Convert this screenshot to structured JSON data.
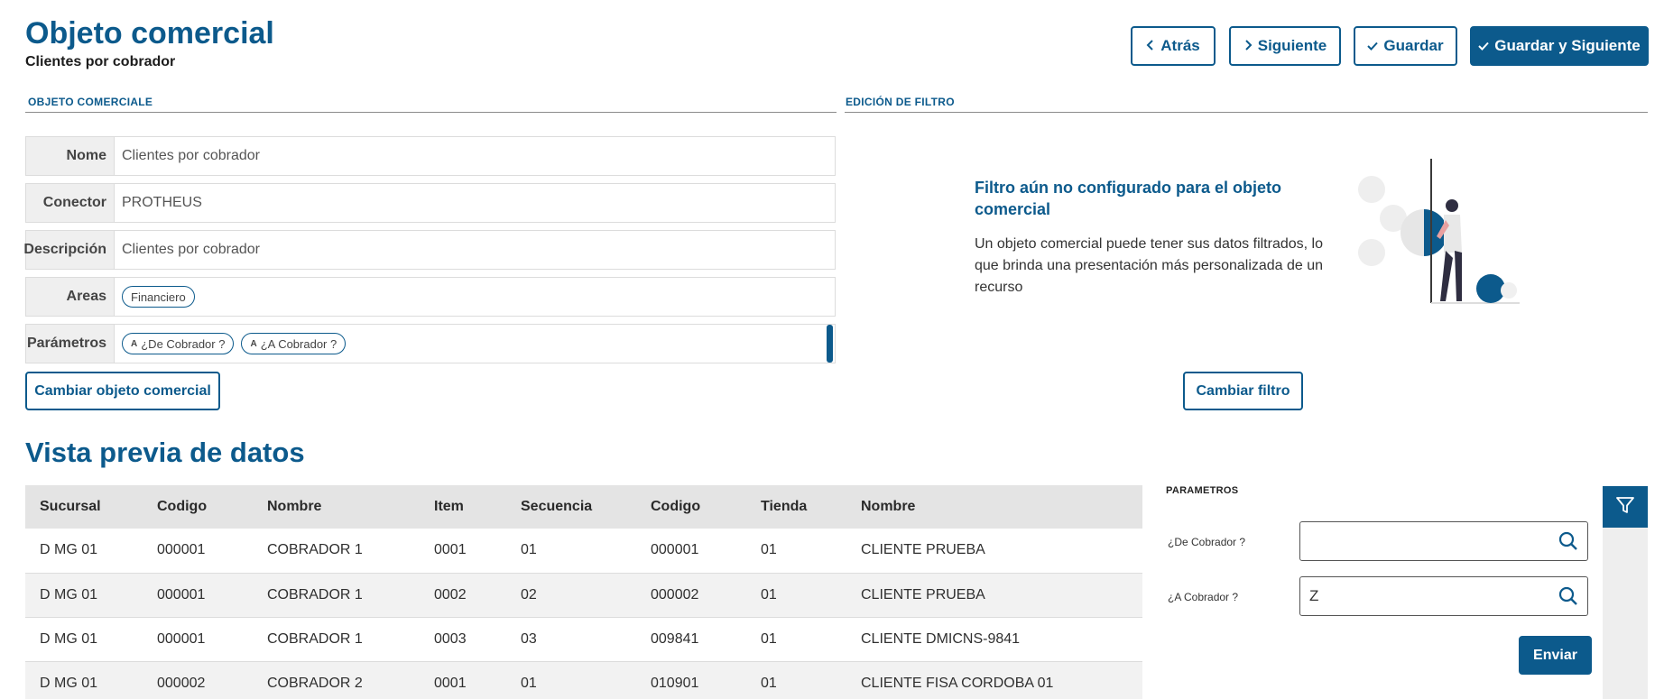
{
  "header": {
    "title": "Objeto comercial",
    "subtitle": "Clientes por cobrador"
  },
  "toolbar": {
    "back_label": "Atrás",
    "next_label": "Siguiente",
    "save_label": "Guardar",
    "save_next_label": "Guardar y Siguiente"
  },
  "object_section": {
    "header": "OBJETO COMERCIALE",
    "fields": {
      "name": {
        "label": "Nome",
        "value": "Clientes por cobrador"
      },
      "connector": {
        "label": "Conector",
        "value": "PROTHEUS"
      },
      "description": {
        "label": "Descripción",
        "value": "Clientes por cobrador"
      },
      "areas": {
        "label": "Areas",
        "chips": [
          "Financiero"
        ]
      },
      "parameters": {
        "label": "Parámetros",
        "chips": [
          "¿De Cobrador ?",
          "¿A Cobrador ?"
        ],
        "chip_icon": "A"
      }
    },
    "change_button": "Cambiar objeto comercial"
  },
  "filter_section": {
    "header": "EDICIÓN DE FILTRO",
    "empty_title": "Filtro aún no configurado para el objeto comercial",
    "empty_desc": "Un objeto comercial puede tener sus datos filtrados, lo que brinda una presentación más personalizada de un recurso",
    "illustration": "person-pushing-ball-illustration",
    "change_button": "Cambiar filtro"
  },
  "preview": {
    "title": "Vista previa de datos",
    "columns": [
      "Sucursal",
      "Codigo",
      "Nombre",
      "Item",
      "Secuencia",
      "Codigo",
      "Tienda",
      "Nombre"
    ],
    "rows": [
      [
        "D MG 01",
        "000001",
        "COBRADOR 1",
        "0001",
        "01",
        "000001",
        "01",
        "CLIENTE PRUEBA"
      ],
      [
        "D MG 01",
        "000001",
        "COBRADOR 1",
        "0002",
        "02",
        "000002",
        "01",
        "CLIENTE PRUEBA"
      ],
      [
        "D MG 01",
        "000001",
        "COBRADOR 1",
        "0003",
        "03",
        "009841",
        "01",
        "CLIENTE DMICNS-9841"
      ],
      [
        "D MG 01",
        "000002",
        "COBRADOR 2",
        "0001",
        "01",
        "010901",
        "01",
        "CLIENTE FISA CORDOBA 01"
      ]
    ]
  },
  "params_panel": {
    "header": "PARAMETROS",
    "items": [
      {
        "label": "¿De Cobrador ?",
        "value": ""
      },
      {
        "label": "¿A Cobrador ?",
        "value": "Z"
      }
    ],
    "submit_label": "Enviar"
  },
  "icons": {
    "back": "chevron-left-icon",
    "next": "chevron-right-icon",
    "save": "check-icon",
    "search": "search-icon",
    "filter": "filter-icon"
  },
  "colors": {
    "primary": "#0c5a8c",
    "header_bg": "#e4e4e4",
    "alt_row": "#f2f2f2"
  }
}
